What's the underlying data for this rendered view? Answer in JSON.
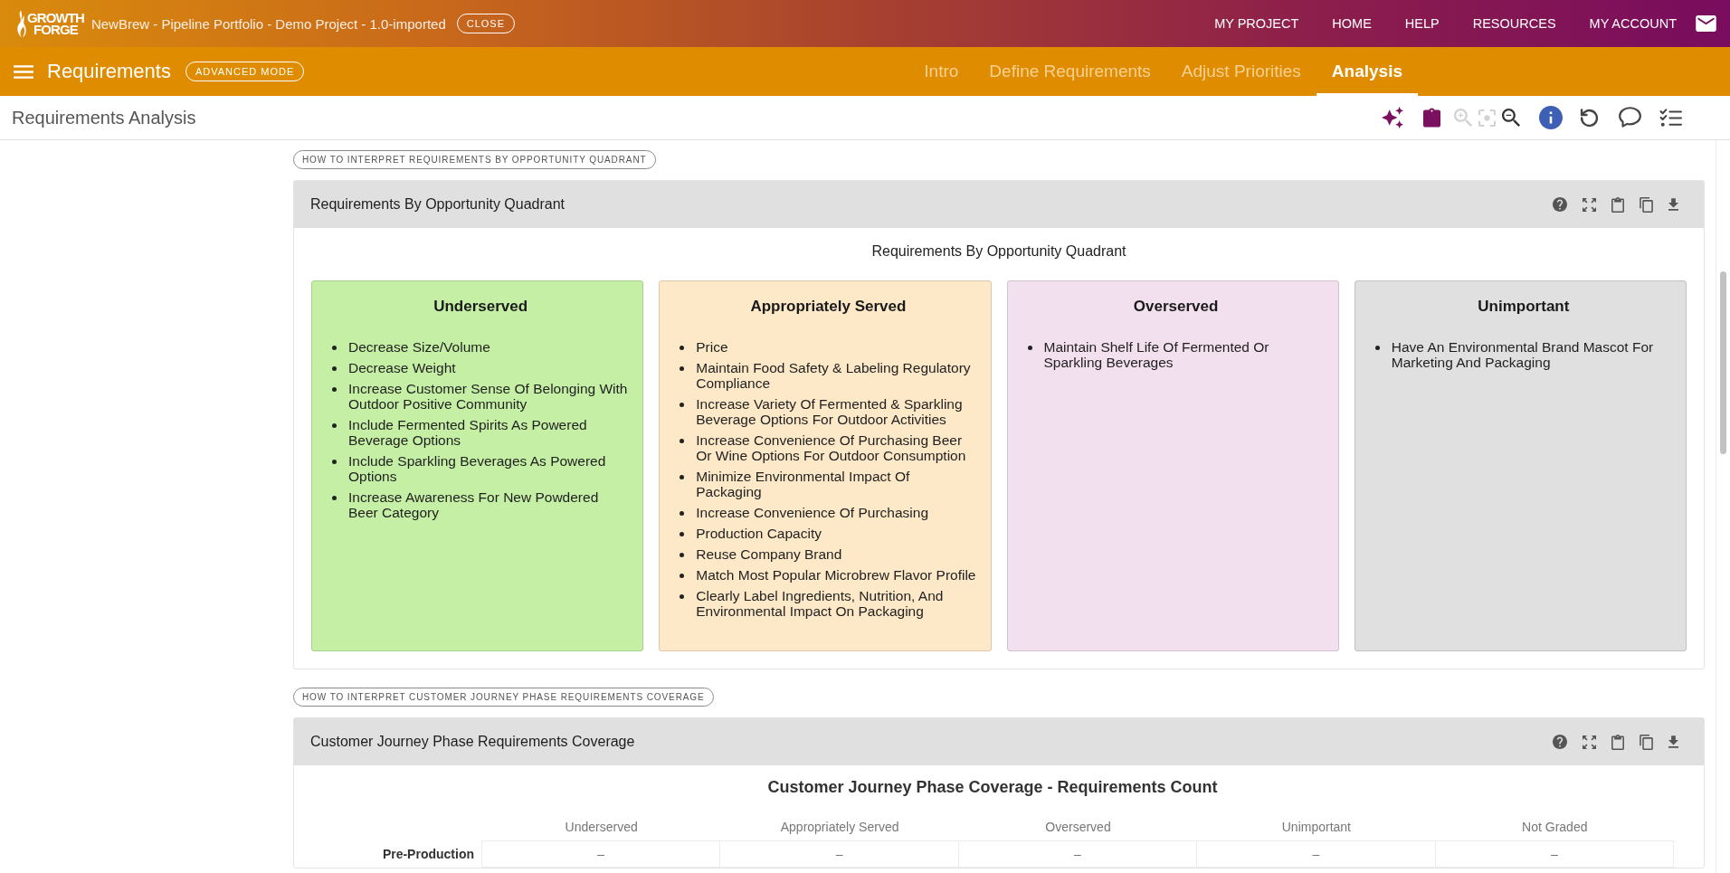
{
  "app_bar": {
    "logo": [
      "GROWTH",
      "FORGE"
    ],
    "project_title": "NewBrew - Pipeline Portfolio - Demo Project - 1.0-imported",
    "close_button": "CLOSE",
    "nav_links": [
      "MY PROJECT",
      "HOME",
      "HELP",
      "RESOURCES",
      "MY ACCOUNT"
    ]
  },
  "module_bar": {
    "title": "Requirements",
    "mode_button": "ADVANCED MODE",
    "tabs": [
      {
        "label": "Intro",
        "selected": false
      },
      {
        "label": "Define Requirements",
        "selected": false
      },
      {
        "label": "Adjust Priorities",
        "selected": false
      },
      {
        "label": "Analysis",
        "selected": true
      }
    ]
  },
  "page_header": {
    "title": "Requirements Analysis",
    "tools": [
      {
        "kind": "sparkles",
        "disabled": false
      },
      {
        "kind": "clipboard",
        "disabled": false
      },
      {
        "kind": "zoom-in",
        "disabled": true
      },
      {
        "kind": "focus",
        "disabled": true
      },
      {
        "kind": "zoom-out",
        "disabled": false
      },
      {
        "kind": "info",
        "disabled": false
      },
      {
        "kind": "undo",
        "disabled": false
      },
      {
        "kind": "comment",
        "disabled": false
      },
      {
        "kind": "checklist",
        "disabled": false
      }
    ]
  },
  "sections": [
    {
      "kind": "quadrants",
      "help_button": "HOW TO INTERPRET REQUIREMENTS BY OPPORTUNITY QUADRANT",
      "card_title": "Requirements By Opportunity Quadrant",
      "chart_title": "Requirements By Opportunity Quadrant",
      "quadrants": [
        {
          "title": "Underserved",
          "color": "#c5efa5",
          "items": [
            "Decrease Size/Volume",
            "Decrease Weight",
            "Increase Customer Sense Of Belonging With Outdoor Positive Community",
            "Include Fermented Spirits As Powered Beverage Options",
            "Include Sparkling Beverages As Powered Options",
            "Increase Awareness For New Powdered Beer Category"
          ]
        },
        {
          "title": "Appropriately Served",
          "color": "#fde8c8",
          "items": [
            "Price",
            "Maintain Food Safety & Labeling Regulatory Compliance",
            "Increase Variety Of Fermented & Sparkling Beverage Options For Outdoor Activities",
            "Increase Convenience Of Purchasing Beer Or Wine Options For Outdoor Consumption",
            "Minimize Environmental Impact Of Packaging",
            "Increase Convenience Of Purchasing",
            "Production Capacity",
            "Reuse Company Brand",
            "Match Most Popular Microbrew Flavor Profile",
            "Clearly Label Ingredients, Nutrition, And Environmental Impact On Packaging"
          ]
        },
        {
          "title": "Overserved",
          "color": "#f2e0ef",
          "items": [
            "Maintain Shelf Life Of Fermented Or Sparkling Beverages"
          ]
        },
        {
          "title": "Unimportant",
          "color": "#e0e0e0",
          "items": [
            "Have An Environmental Brand Mascot For Marketing And Packaging"
          ]
        }
      ]
    },
    {
      "kind": "coverage_table",
      "help_button": "HOW TO INTERPRET CUSTOMER JOURNEY PHASE REQUIREMENTS COVERAGE",
      "card_title": "Customer Journey Phase Requirements Coverage",
      "table_title": "Customer Journey Phase Coverage - Requirements Count",
      "columns": [
        "Underserved",
        "Appropriately Served",
        "Overserved",
        "Unimportant",
        "Not Graded"
      ],
      "rows": [
        {
          "label": "Pre-Production",
          "cells": [
            "–",
            "–",
            "–",
            "–",
            "–"
          ]
        }
      ]
    }
  ]
}
